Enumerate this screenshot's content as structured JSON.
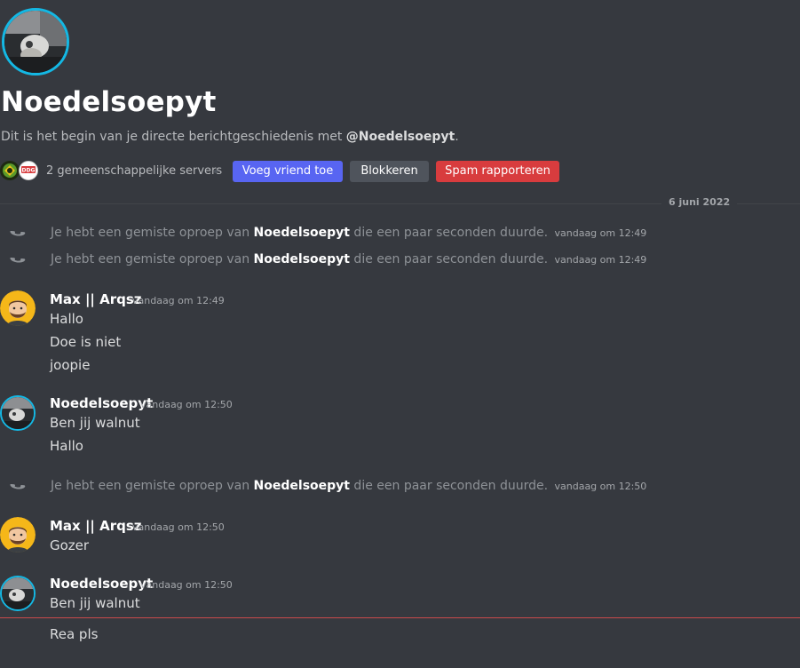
{
  "profile": {
    "name": "Noedelsoepyt",
    "intro_prefix": "Dit is het begin van je directe berichtgeschiedenis met ",
    "intro_mention": "@Noedelsoepyt",
    "intro_suffix": "."
  },
  "mutual": {
    "server_icon_2_text": "DDG",
    "text": "2 gemeenschappelijke servers"
  },
  "buttons": {
    "add_friend": "Voeg vriend toe",
    "block": "Blokkeren",
    "report_spam": "Spam rapporteren"
  },
  "date_divider": "6 juni 2022",
  "system": {
    "prefix": "Je hebt een gemiste oproep van ",
    "user": "Noedelsoepyt",
    "suffix": " die een paar seconden duurde.",
    "times": [
      "vandaag om 12:49",
      "vandaag om 12:49",
      "vandaag om 12:50"
    ]
  },
  "messages": [
    {
      "author": "Max || Arqsz",
      "time": "vandaag om 12:49",
      "lines": [
        "Hallo",
        "Doe is niet",
        "joopie"
      ]
    },
    {
      "author": "Noedelsoepyt",
      "time": "vandaag om 12:50",
      "lines": [
        "Ben jij walnut",
        "Hallo"
      ]
    },
    {
      "author": "Max || Arqsz",
      "time": "vandaag om 12:50",
      "lines": [
        "Gozer"
      ]
    },
    {
      "author": "Noedelsoepyt",
      "time": "vandaag om 12:50",
      "lines": [
        "Ben jij walnut"
      ]
    }
  ],
  "new_message": "Rea pls",
  "colors": {
    "background": "#36393f",
    "blurple": "#5865f2",
    "danger": "#d83c3e",
    "secondary": "#4f545c",
    "new_divider": "#c94a4c"
  }
}
